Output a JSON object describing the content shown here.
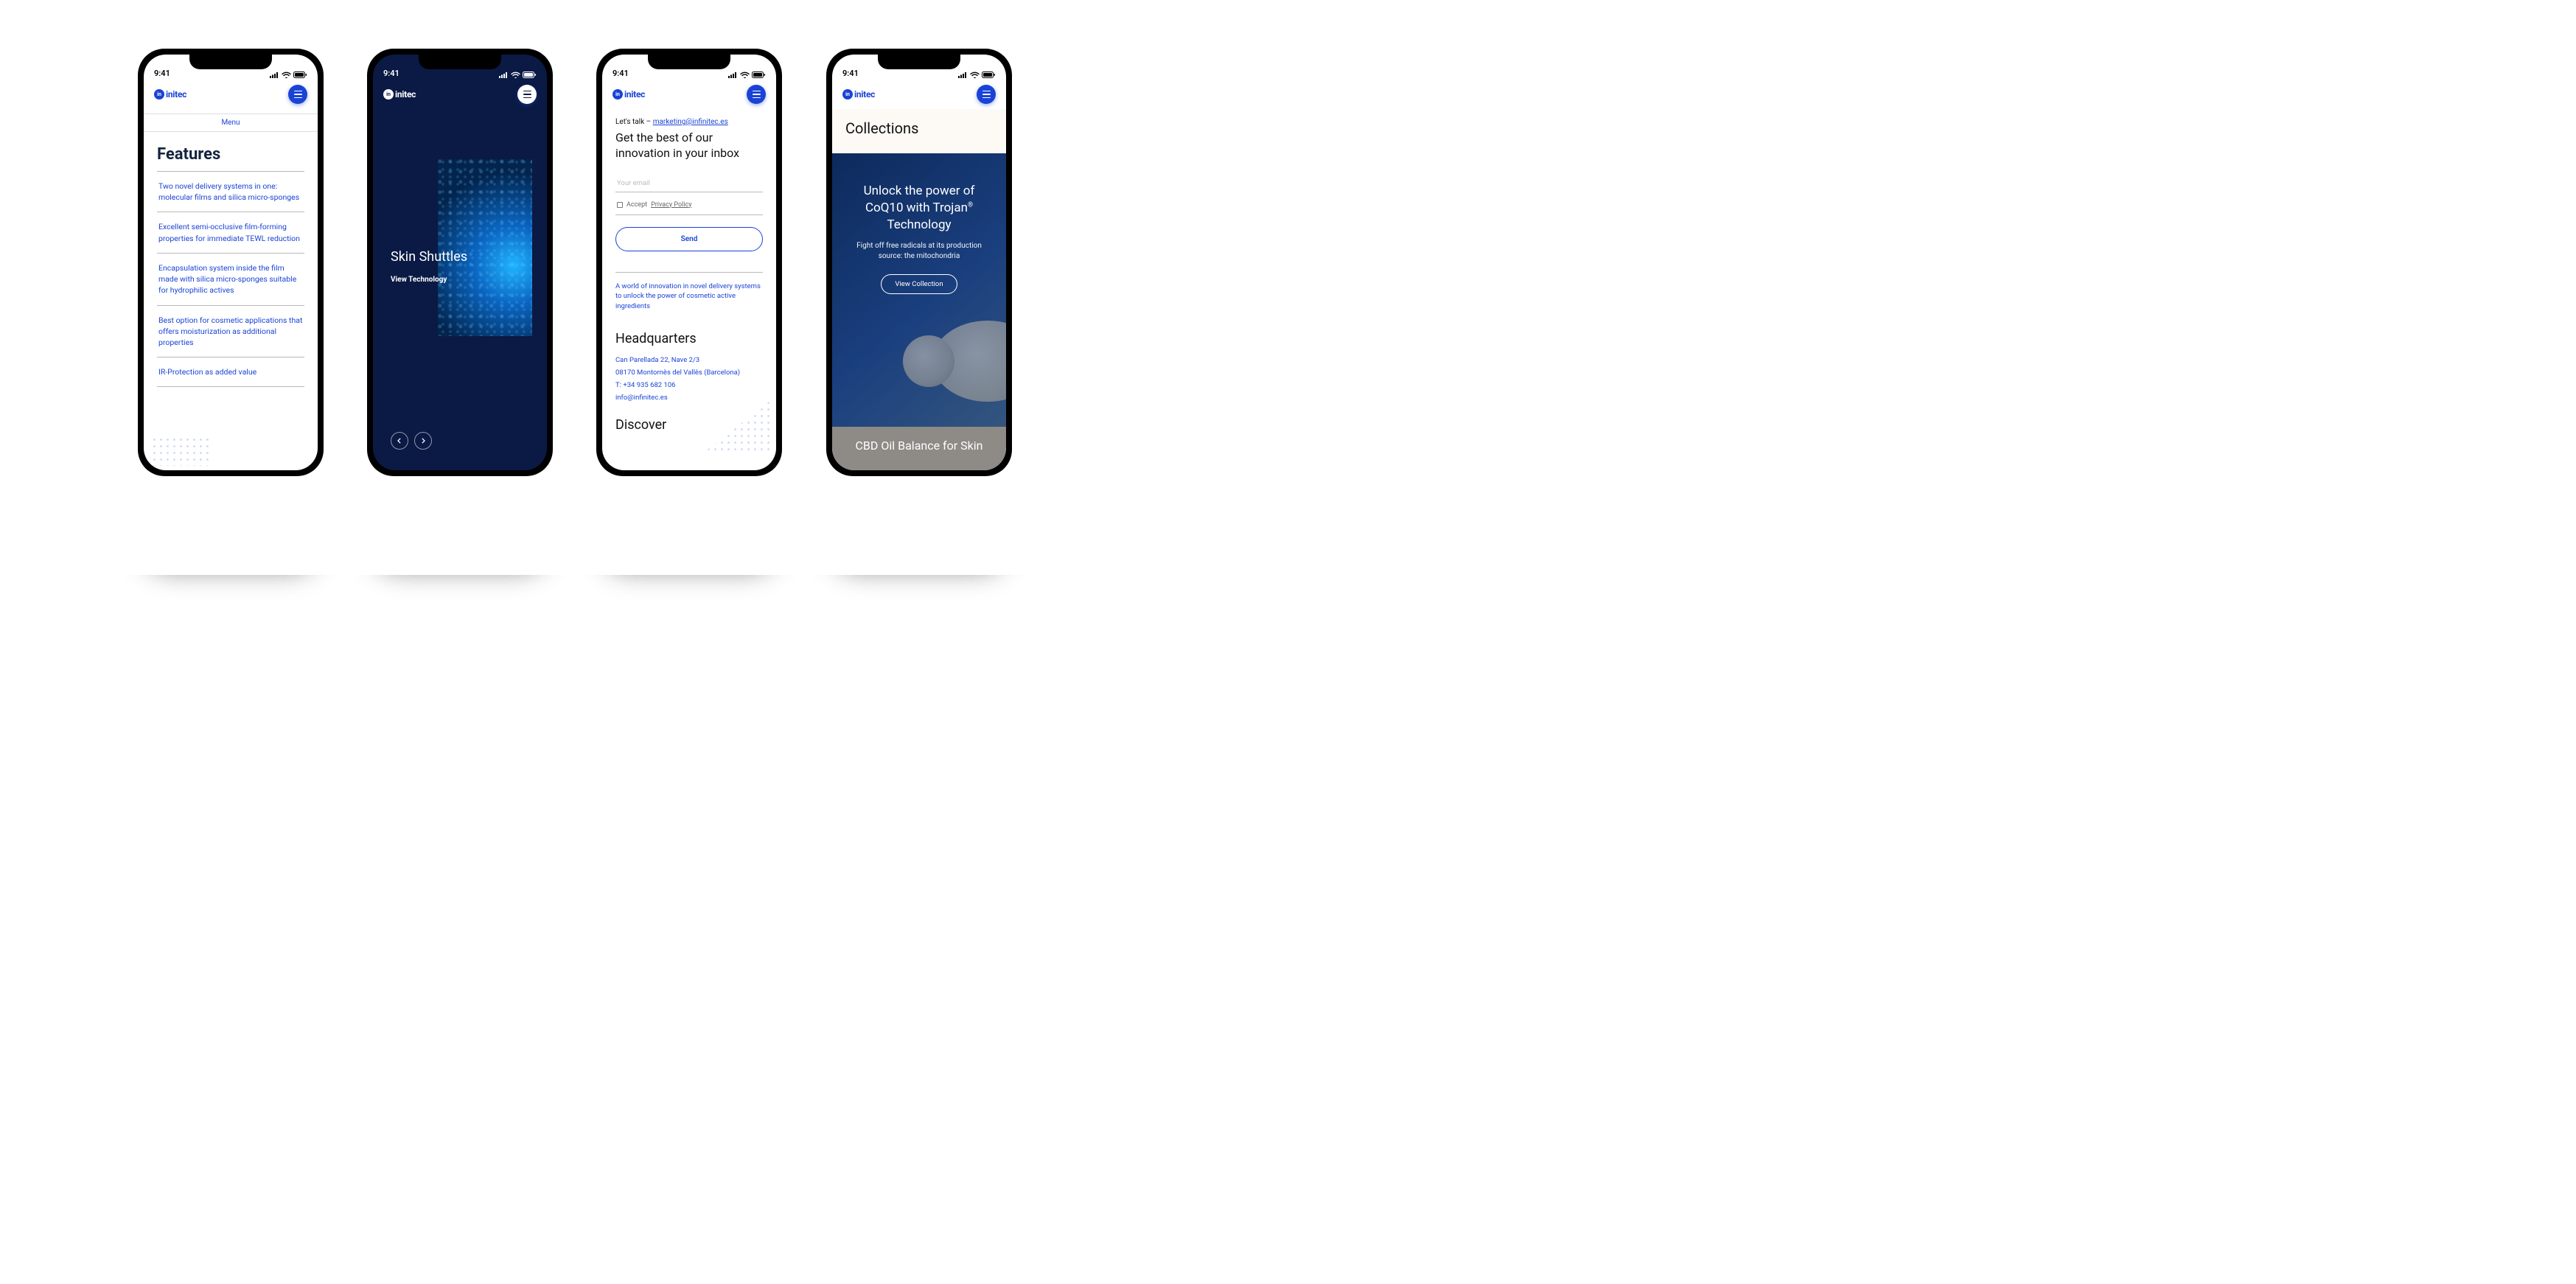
{
  "status": {
    "time": "9:41"
  },
  "logo": {
    "text": "initec"
  },
  "screen1": {
    "menu_label": "Menu",
    "title": "Features",
    "features": [
      "Two novel delivery systems in one: molecular films and silica micro-sponges",
      "Excellent semi-occlusive film-forming properties for immediate TEWL reduction",
      "Encapsulation system inside the film made with silica micro-sponges suitable for hydrophilic actives",
      "Best option for cosmetic applications that offers moisturization as additional properties",
      "IR-Protection as added value"
    ]
  },
  "screen2": {
    "title": "Skin Shuttles",
    "link": "View Technology"
  },
  "screen3": {
    "talk_prefix": "Let's talk – ",
    "talk_email": "marketing@infinitec.es",
    "headline": "Get the best of our innovation in your inbox",
    "email_placeholder": "Your email",
    "accept": "Accept",
    "privacy": "Privacy Policy",
    "send": "Send",
    "tagline": "A world of innovation in novel delivery systems to unlock the power of cosmetic active ingredients",
    "hq_title": "Headquarters",
    "addr1": "Can Parellada 22, Nave 2/3",
    "addr2": "08170 Montornès del Vallès (Barcelona)",
    "phone": "T: +34 935 682 106",
    "info_email": "info@infinitec.es",
    "discover_title": "Discover"
  },
  "screen4": {
    "collections": "Collections",
    "hero_line1": "Unlock the power of",
    "hero_line2a": "CoQ10 with Trojan",
    "hero_line2b": "Technology",
    "hero_sub": "Fight off free radicals at its production source: the mitochondria",
    "view": "View Collection",
    "footer": "CBD Oil Balance for Skin"
  }
}
